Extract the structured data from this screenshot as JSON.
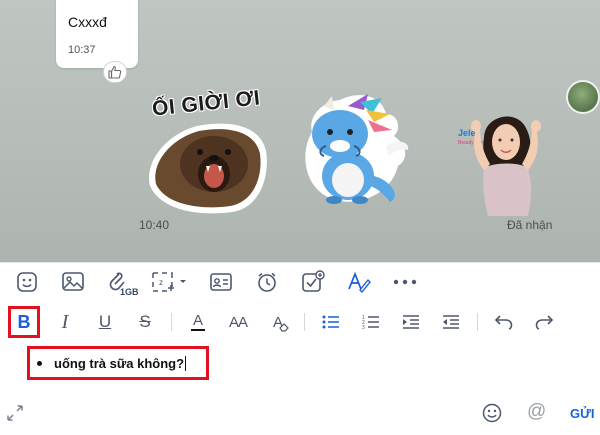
{
  "chat": {
    "message_text": "Cxxxđ",
    "message_time": "10:37",
    "sticker_caption": "ỐI GIỜI ƠI",
    "sticker_group_time": "10:40",
    "status": "Đã nhận"
  },
  "toolbar": {
    "icons": [
      "sticker-icon",
      "image-icon",
      "attachment-icon",
      "screenshot-icon",
      "contact-card-icon",
      "reminder-icon",
      "task-icon",
      "text-format-icon",
      "more-icon"
    ],
    "attachment_limit": "1GB"
  },
  "format_bar": {
    "bold": "B",
    "italic": "I",
    "underline": "U",
    "strikethrough": "S",
    "font_color": "A",
    "font_size": "AA",
    "clear_format": "A"
  },
  "editor": {
    "text": "uống trà sữa không?"
  },
  "bottom": {
    "mention": "@",
    "send_label": "GỬI"
  },
  "colors": {
    "accent": "#1a5fd9",
    "highlight": "#e3101f",
    "chat_background": "#b6bdb8"
  }
}
